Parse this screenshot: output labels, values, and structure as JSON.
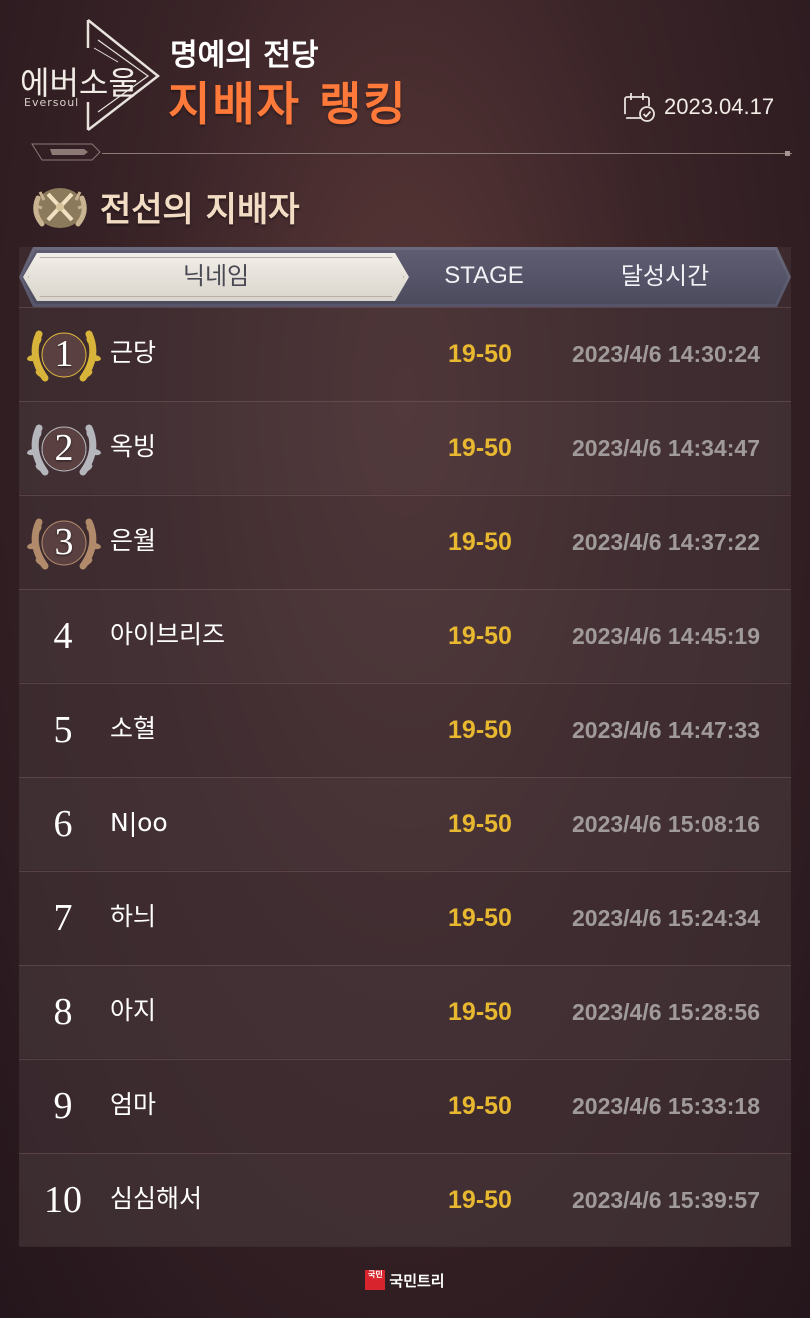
{
  "header": {
    "logo_kr": "에버소울",
    "logo_en": "Eversoul",
    "title_sub": "명예의 전당",
    "title_main": "지배자 랭킹",
    "date": "2023.04.17"
  },
  "section": {
    "title": "전선의 지배자"
  },
  "table": {
    "columns": [
      "닉네임",
      "STAGE",
      "달성시간"
    ],
    "active_tab": "닉네임",
    "rows": [
      {
        "rank": "1",
        "medal": "gold",
        "nickname": "근당",
        "stage": "19-50",
        "time": "2023/4/6 14:30:24"
      },
      {
        "rank": "2",
        "medal": "silver",
        "nickname": "옥빙",
        "stage": "19-50",
        "time": "2023/4/6 14:34:47"
      },
      {
        "rank": "3",
        "medal": "bronze",
        "nickname": "은월",
        "stage": "19-50",
        "time": "2023/4/6 14:37:22"
      },
      {
        "rank": "4",
        "medal": "",
        "nickname": "아이브리즈",
        "stage": "19-50",
        "time": "2023/4/6 14:45:19"
      },
      {
        "rank": "5",
        "medal": "",
        "nickname": "소혈",
        "stage": "19-50",
        "time": "2023/4/6 14:47:33"
      },
      {
        "rank": "6",
        "medal": "",
        "nickname": "N|oo",
        "stage": "19-50",
        "time": "2023/4/6 15:08:16"
      },
      {
        "rank": "7",
        "medal": "",
        "nickname": "하늬",
        "stage": "19-50",
        "time": "2023/4/6 15:24:34"
      },
      {
        "rank": "8",
        "medal": "",
        "nickname": "아지",
        "stage": "19-50",
        "time": "2023/4/6 15:28:56"
      },
      {
        "rank": "9",
        "medal": "",
        "nickname": "엄마",
        "stage": "19-50",
        "time": "2023/4/6 15:33:18"
      },
      {
        "rank": "10",
        "medal": "",
        "nickname": "심심해서",
        "stage": "19-50",
        "time": "2023/4/6 15:39:57"
      }
    ]
  },
  "footer": {
    "logo_text": "국민",
    "brand": "국민트리"
  },
  "colors": {
    "title_orange": "#ff7a3a",
    "stage_gold": "#e8b830",
    "time_gray": "#a09a9a",
    "medal_gold": "#d9b43a",
    "medal_silver": "#b4b6bc",
    "medal_bronze": "#b08a6a"
  },
  "icons": {
    "date": "calendar-check-icon",
    "section": "crossed-swords-laurel-icon"
  }
}
